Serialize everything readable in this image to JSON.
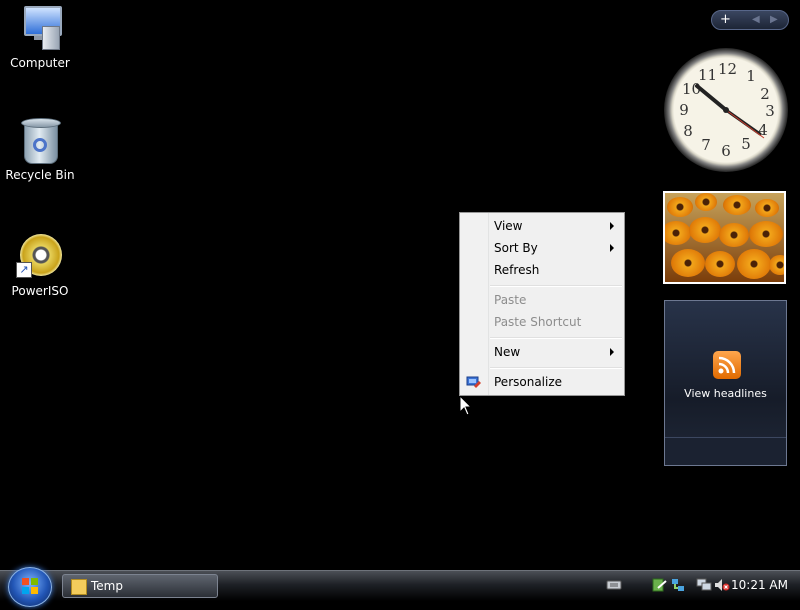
{
  "desktop": {
    "icons": [
      {
        "label": "Computer",
        "icon": "computer-icon"
      },
      {
        "label": "Recycle Bin",
        "icon": "recycle-bin-icon"
      },
      {
        "label": "PowerISO",
        "icon": "poweriso-disc-icon"
      }
    ]
  },
  "context_menu": {
    "items": [
      {
        "label": "View",
        "submenu": true,
        "enabled": true
      },
      {
        "label": "Sort By",
        "submenu": true,
        "enabled": true
      },
      {
        "label": "Refresh",
        "submenu": false,
        "enabled": true
      },
      {
        "label": "Paste",
        "submenu": false,
        "enabled": false
      },
      {
        "label": "Paste Shortcut",
        "submenu": false,
        "enabled": false
      },
      {
        "label": "New",
        "submenu": true,
        "enabled": true
      },
      {
        "label": "Personalize",
        "submenu": false,
        "enabled": true,
        "icon": "personalize-icon"
      }
    ]
  },
  "gadgets": {
    "sidebar_controls": {
      "add": "+",
      "prev": "◀",
      "next": "▶"
    },
    "clock": {
      "numbers": [
        "12",
        "1",
        "2",
        "3",
        "4",
        "5",
        "6",
        "7",
        "8",
        "9",
        "10",
        "11"
      ],
      "time": "10:21"
    },
    "slideshow": {
      "subject": "orange flowers"
    },
    "feed": {
      "label": "View headlines",
      "icon": "rss-feed-icon"
    }
  },
  "taskbar": {
    "start_icon": "windows-start-orb",
    "buttons": [
      {
        "label": "Temp",
        "icon": "folder-icon"
      }
    ],
    "tray": {
      "time": "10:21 AM",
      "icons": [
        "keyboard-icon",
        "security-icon",
        "network-icon",
        "network-connections-icon",
        "volume-muted-icon"
      ]
    }
  },
  "colors": {
    "desktop_background": "#000000",
    "menu_background": "#f0f0f0",
    "disabled_text": "#8d8d8d",
    "rss_orange": "#f08a1c"
  }
}
